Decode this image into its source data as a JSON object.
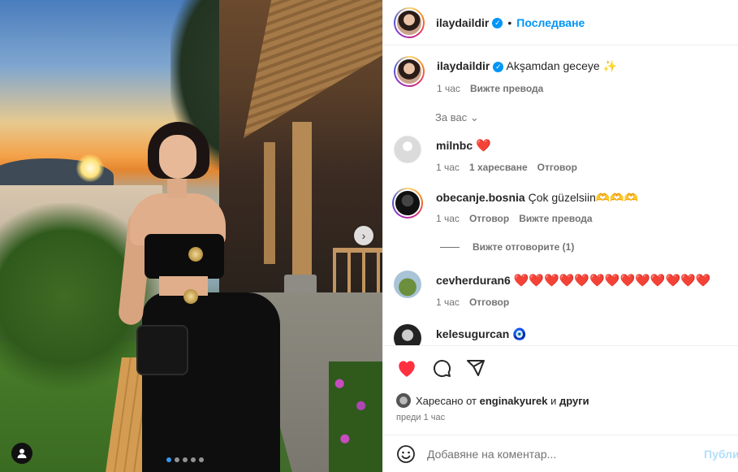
{
  "post": {
    "username": "ilaydaildir",
    "follow_label": "Последване",
    "separator": "•"
  },
  "caption": {
    "username": "ilaydaildir",
    "text": "Akşamdan geceye ✨",
    "time": "1 час",
    "translate": "Вижте превода"
  },
  "for_you_label": "За вас",
  "comments": [
    {
      "username": "milnbc",
      "text": "❤️",
      "time": "1 час",
      "likes": "1 харесване",
      "reply": "Отговор"
    },
    {
      "username": "obecanje.bosnia",
      "text": "Çok güzelsiin🫶🫶🫶",
      "time": "1 час",
      "reply": "Отговор",
      "translate": "Вижте превода",
      "view_replies": "Вижте отговорите (1)"
    },
    {
      "username": "cevherduran6",
      "text": "❤️❤️❤️❤️❤️❤️❤️❤️❤️❤️❤️❤️❤️",
      "time": "1 час",
      "reply": "Отговор"
    },
    {
      "username": "kelesugurcan",
      "text": "🧿"
    }
  ],
  "likes": {
    "prefix": "Харесано от",
    "user": "enginakyurek",
    "joiner": "и",
    "others": "други",
    "time_ago": "преди 1 час"
  },
  "composer": {
    "placeholder": "Добавяне на коментар...",
    "post_label": "Публикуване"
  },
  "carousel": {
    "slides": 5,
    "active_index": 0
  },
  "colors": {
    "accent": "#0095f6",
    "like": "#ed1c2e",
    "post_disabled": "#b2dffc"
  }
}
